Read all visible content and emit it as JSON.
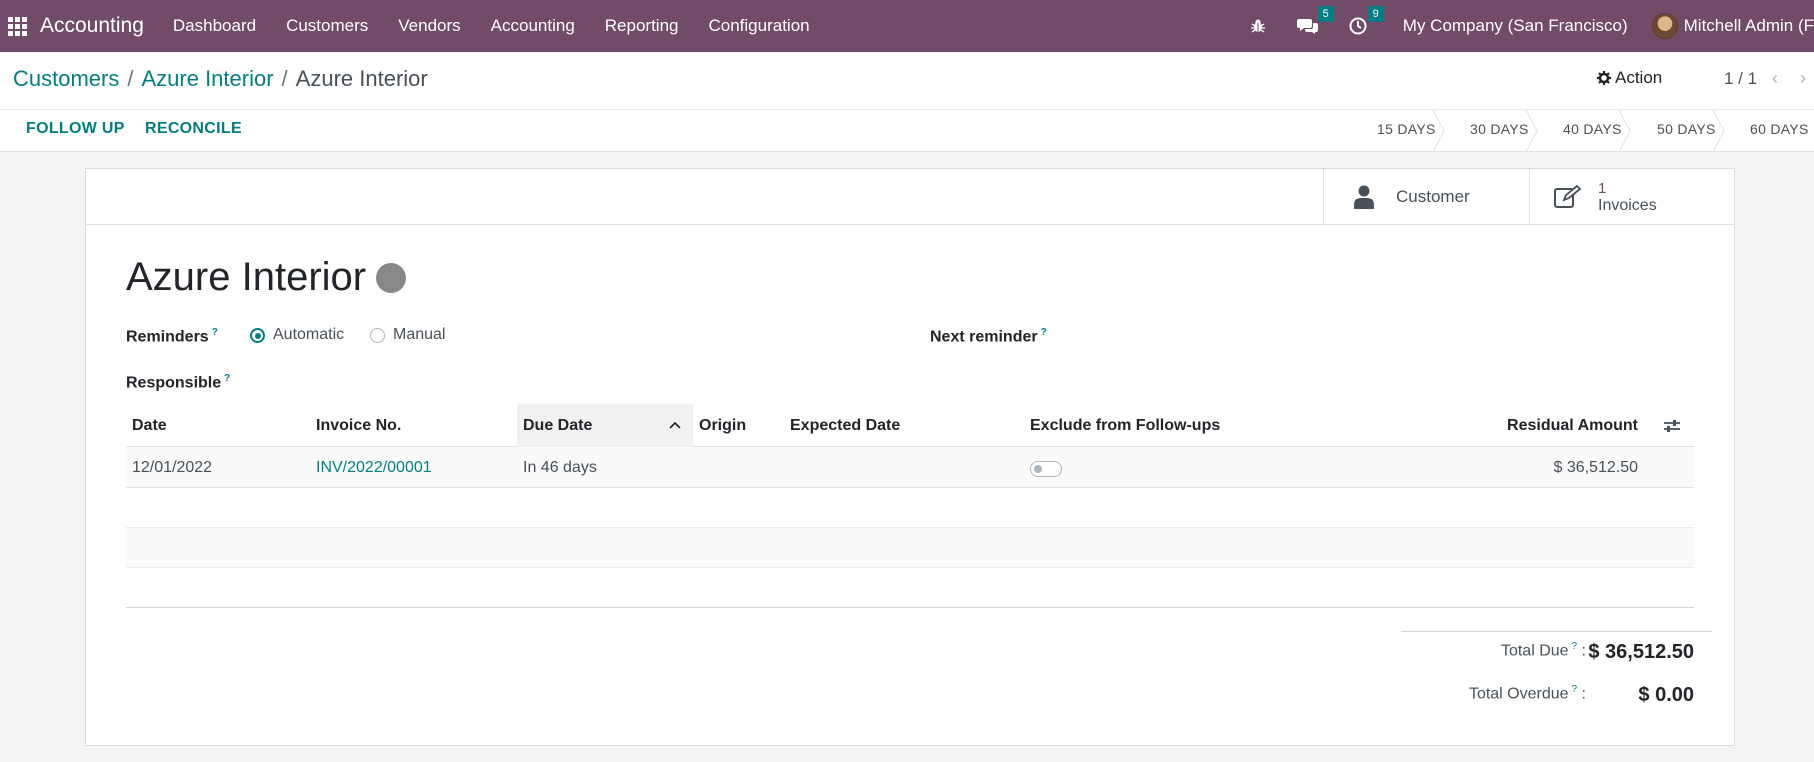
{
  "navbar": {
    "app_name": "Accounting",
    "menu": [
      "Dashboard",
      "Customers",
      "Vendors",
      "Accounting",
      "Reporting",
      "Configuration"
    ],
    "messages_count": "5",
    "activities_count": "9",
    "company": "My Company (San Francisco)",
    "user": "Mitchell Admin (F"
  },
  "breadcrumb": {
    "items": [
      "Customers",
      "Azure Interior"
    ],
    "current": "Azure Interior",
    "separator": "/"
  },
  "control": {
    "action_label": "Action",
    "pager": "1 / 1",
    "buttons": [
      "FOLLOW UP",
      "RECONCILE"
    ],
    "stages": [
      "15 DAYS",
      "30 DAYS",
      "40 DAYS",
      "50 DAYS",
      "60 DAYS"
    ]
  },
  "stat_buttons": {
    "customer_label": "Customer",
    "invoices_count": "1",
    "invoices_label": "Invoices"
  },
  "form": {
    "title": "Azure Interior",
    "reminders_label": "Reminders",
    "reminders_options": [
      "Automatic",
      "Manual"
    ],
    "reminders_selected": "Automatic",
    "next_reminder_label": "Next reminder",
    "responsible_label": "Responsible",
    "help_mark": "?"
  },
  "table": {
    "columns": [
      "Date",
      "Invoice No.",
      "Due Date",
      "Origin",
      "Expected Date",
      "Exclude from Follow-ups",
      "Residual Amount"
    ],
    "rows": [
      {
        "date": "12/01/2022",
        "invoice": "INV/2022/00001",
        "due": "In 46 days",
        "origin": "",
        "expected": "",
        "exclude": false,
        "residual": "$ 36,512.50"
      }
    ]
  },
  "totals": {
    "total_due_label": "Total Due",
    "total_due": "$ 36,512.50",
    "total_overdue_label": "Total Overdue",
    "total_overdue": "$ 0.00"
  },
  "colors": {
    "navbar": "#714b67",
    "accent": "#017e84"
  }
}
